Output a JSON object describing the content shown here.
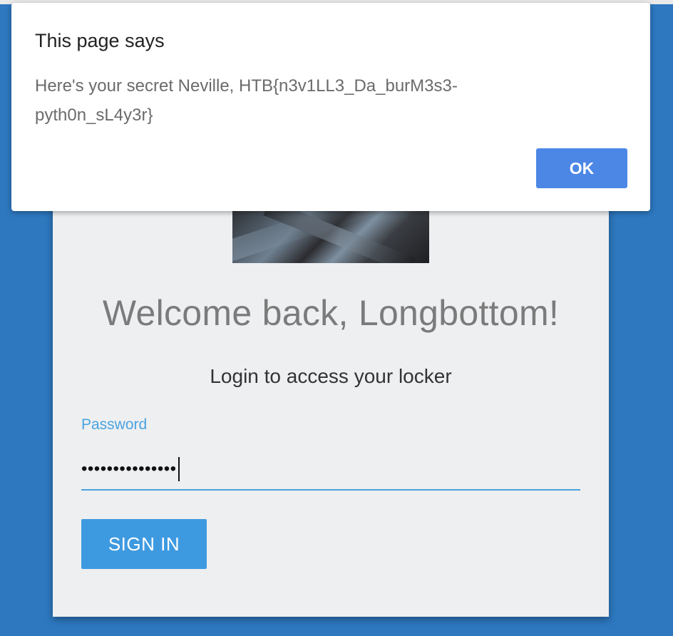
{
  "dialog": {
    "title": "This page says",
    "message_line1": "Here's your secret Neville, HTB{n3v1LL3_Da_burM3s3-",
    "message_line2": "pyth0n_sL4y3r}",
    "ok_label": "OK"
  },
  "login": {
    "welcome": "Welcome back, Longbottom!",
    "subtitle": "Login to access your locker",
    "password_label": "Password",
    "password_value": "•••••••••••••••",
    "signin_label": "SIGN IN"
  },
  "colors": {
    "background": "#2d78bf",
    "accent": "#3e9ae0",
    "dialog_button": "#4c87e6"
  }
}
